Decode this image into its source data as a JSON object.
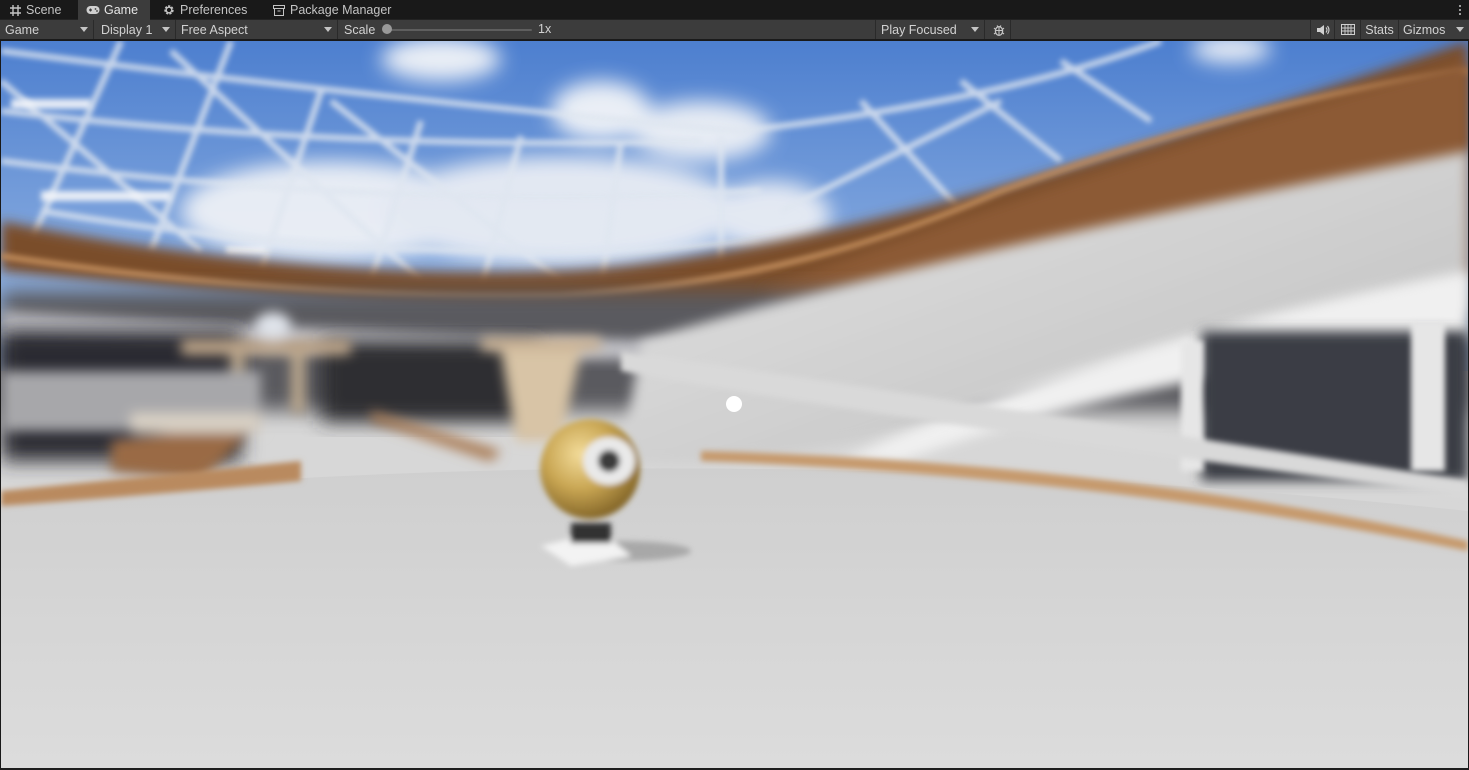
{
  "tabs": [
    {
      "label": "Scene",
      "icon": "grid-hash-icon",
      "active": false
    },
    {
      "label": "Game",
      "icon": "gamepad-icon",
      "active": true
    },
    {
      "label": "Preferences",
      "icon": "gear-icon",
      "active": false
    },
    {
      "label": "Package Manager",
      "icon": "package-icon",
      "active": false
    }
  ],
  "toolbar": {
    "view_mode": "Game",
    "display": "Display 1",
    "aspect": "Free Aspect",
    "scale_label": "Scale",
    "scale_value": "1x",
    "play_mode": "Play Focused",
    "stats_label": "Stats",
    "gizmos_label": "Gizmos"
  },
  "colors": {
    "panel_bg": "#3c3c3c",
    "tab_strip_bg": "#191919",
    "text": "#c4c4c4",
    "sky": "#5d8ed6",
    "floor": "#d5d5d5",
    "wood": "#8a5a36"
  }
}
